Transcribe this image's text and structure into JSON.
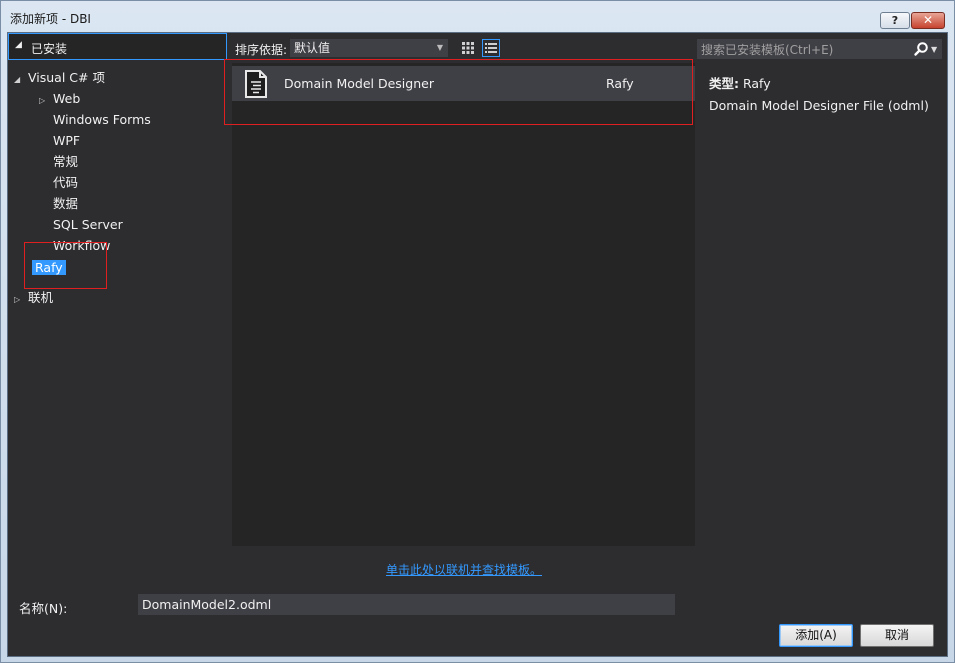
{
  "window": {
    "title": "添加新项 - DBI",
    "help_label": "?",
    "close_label": "✕"
  },
  "left": {
    "header_label": "已安装",
    "tree": [
      {
        "label": "Visual C# 项",
        "expander": "◢",
        "level": 0
      },
      {
        "label": "Web",
        "expander": "▷",
        "level": 1
      },
      {
        "label": "Windows Forms",
        "expander": "",
        "level": 2
      },
      {
        "label": "WPF",
        "expander": "",
        "level": 2
      },
      {
        "label": "常规",
        "expander": "",
        "level": 2
      },
      {
        "label": "代码",
        "expander": "",
        "level": 2
      },
      {
        "label": "数据",
        "expander": "",
        "level": 2
      },
      {
        "label": "SQL Server",
        "expander": "",
        "level": 2
      },
      {
        "label": "Workflow",
        "expander": "",
        "level": 2
      },
      {
        "label": "Rafy",
        "expander": "",
        "level": 1,
        "selected": true
      },
      {
        "label": "联机",
        "expander": "▷",
        "level": 0
      }
    ]
  },
  "middle": {
    "sort_label": "排序依据:",
    "sort_value": "默认值",
    "templates": [
      {
        "name": "Domain Model Designer",
        "category": "Rafy"
      }
    ],
    "online_link": "单击此处以联机并查找模板。"
  },
  "right": {
    "search_placeholder": "搜索已安装模板(Ctrl+E)",
    "type_key": "类型:",
    "type_value": "Rafy",
    "description": "Domain Model Designer File (odml)"
  },
  "bottom": {
    "name_label": "名称(N):",
    "name_value": "DomainModel2.odml",
    "add_label": "添加(A)",
    "cancel_label": "取消"
  },
  "colors": {
    "selection": "#3399ff",
    "annotation_red": "#e02020",
    "background": "#2d2d30"
  }
}
